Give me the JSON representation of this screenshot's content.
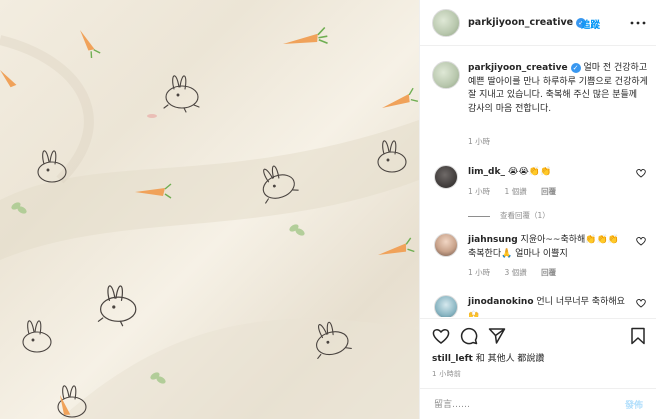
{
  "post_image": {
    "alt_icon_names": [
      "bunny-pattern-icon",
      "carrot-pattern-icon",
      "leaf-pattern-icon"
    ]
  },
  "header": {
    "username": "parkjiyoon_creative",
    "verified_icon": "✓",
    "follow_label": "追蹤"
  },
  "caption": {
    "username": "parkjiyoon_creative",
    "text": "얼마 전 건강하고 예쁜 딸아이를 만나 하루하루 기쁨으로 건강하게 잘 지내고 있습니다. 축복해 주신 많은 분들께 감사의 마음 전합니다.",
    "time": "1 小時"
  },
  "comments": [
    {
      "username": "lim_dk_",
      "text": "😭😭👏👏",
      "time": "1 小時",
      "likes": "1 個讚",
      "reply_label": "回覆",
      "view_replies": "查看回覆（1）"
    },
    {
      "username": "jiahnsung",
      "text": "지윤아~~축하해👏👏👏 축복한다🙏 얼마나 이쁠지",
      "time": "1 小時",
      "likes": "3 個讚",
      "reply_label": "回覆"
    },
    {
      "username": "jinodanokino",
      "text": "언니 너무너무 축하해요🙌"
    }
  ],
  "actions": {
    "liked_by_user": "still_left",
    "liked_by_suffix": "和 其他人 都說讚",
    "timestamp": "1 小時前"
  },
  "add_comment": {
    "placeholder": "留言……",
    "post_label": "發佈"
  },
  "colors": {
    "accent": "#0095f6",
    "verified": "#3897f0",
    "muted": "#8e8e8e",
    "border": "#efefef"
  }
}
